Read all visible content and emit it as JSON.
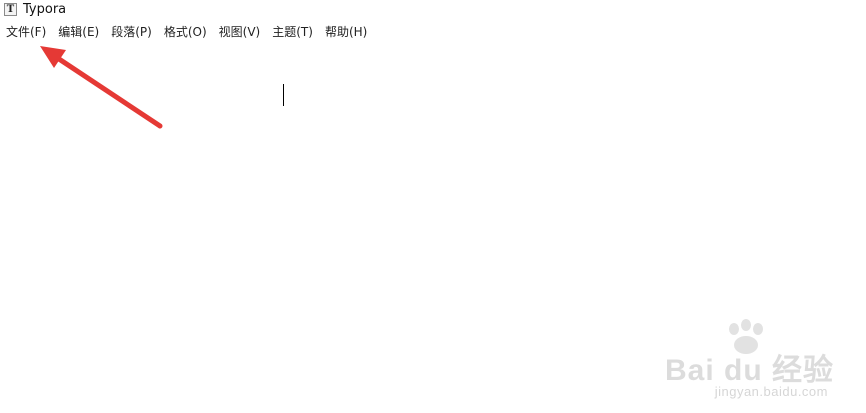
{
  "window": {
    "title": "Typora",
    "icon_letter": "T"
  },
  "menu": {
    "items": [
      {
        "label": "文件(F)"
      },
      {
        "label": "编辑(E)"
      },
      {
        "label": "段落(P)"
      },
      {
        "label": "格式(O)"
      },
      {
        "label": "视图(V)"
      },
      {
        "label": "主题(T)"
      },
      {
        "label": "帮助(H)"
      }
    ]
  },
  "annotation": {
    "arrow_color": "#e53935"
  },
  "watermark": {
    "main": "Bai du 经验",
    "url": "jingyan.baidu.com"
  }
}
